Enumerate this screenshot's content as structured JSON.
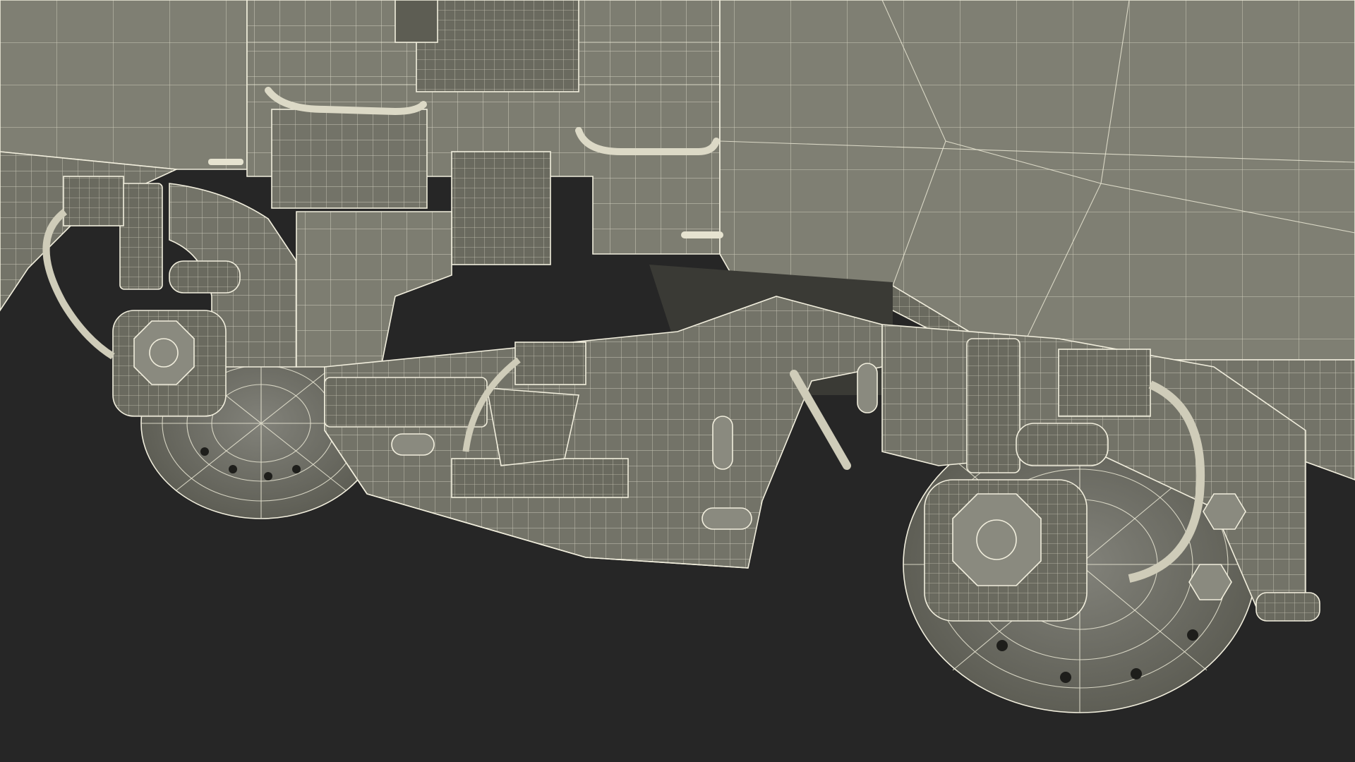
{
  "scene": {
    "background_color": "#262626",
    "surface_color": "#7a7a6e",
    "surface_dark_color": "#5d5d53",
    "wire_color": "#e9e6d4"
  }
}
